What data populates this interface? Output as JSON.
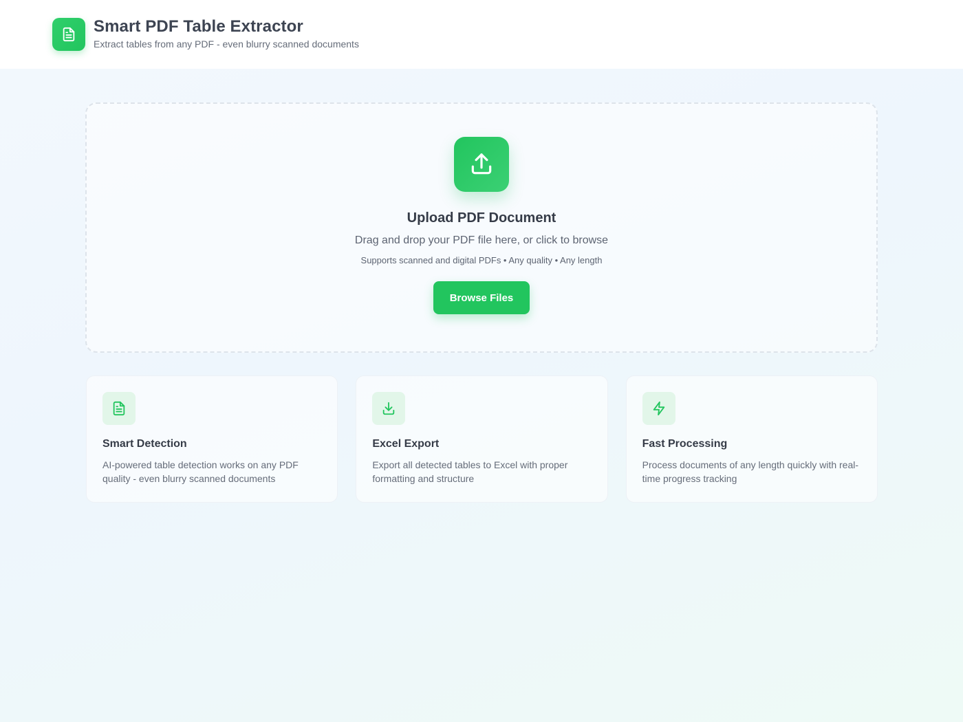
{
  "header": {
    "title": "Smart PDF Table Extractor",
    "subtitle": "Extract tables from any PDF - even blurry scanned documents",
    "logo_icon": "document-icon"
  },
  "upload": {
    "icon": "upload-icon",
    "title": "Upload PDF Document",
    "description": "Drag and drop your PDF file here, or click to browse",
    "note": "Supports scanned and digital PDFs • Any quality • Any length",
    "button_label": "Browse Files"
  },
  "features": [
    {
      "icon": "document-icon",
      "title": "Smart Detection",
      "description": "AI-powered table detection works on any PDF quality - even blurry scanned documents"
    },
    {
      "icon": "download-icon",
      "title": "Excel Export",
      "description": "Export all detected tables to Excel with proper formatting and structure"
    },
    {
      "icon": "lightning-icon",
      "title": "Fast Processing",
      "description": "Process documents of any length quickly with real-time progress tracking"
    }
  ],
  "colors": {
    "accent": "#22c55e",
    "icon_bg": "#e2f6e9",
    "text_primary": "#353b47",
    "text_secondary": "#656c79"
  }
}
